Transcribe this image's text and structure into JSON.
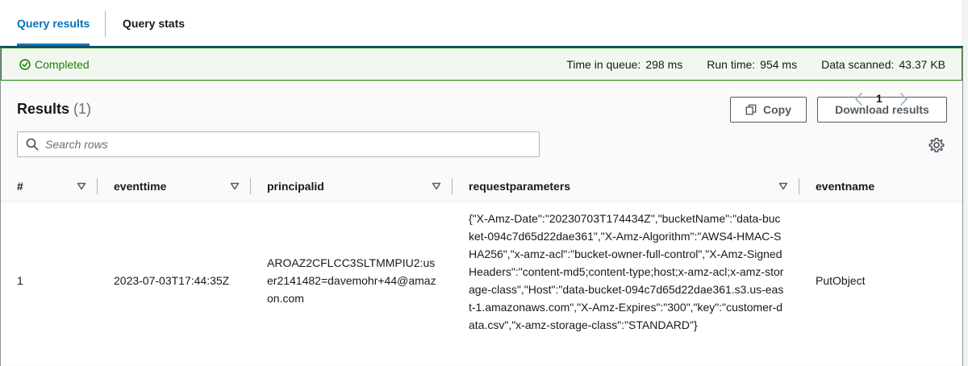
{
  "tabs": [
    {
      "label": "Query results",
      "active": true
    },
    {
      "label": "Query stats",
      "active": false
    }
  ],
  "status": {
    "label": "Completed",
    "icon": "check-circle-icon",
    "color": "#1d8102",
    "stats": [
      {
        "label": "Time in queue:",
        "value": "298 ms"
      },
      {
        "label": "Run time:",
        "value": "954 ms"
      },
      {
        "label": "Data scanned:",
        "value": "43.37 KB"
      }
    ]
  },
  "results": {
    "title": "Results",
    "count": "(1)",
    "copy_label": "Copy",
    "download_label": "Download results",
    "search_placeholder": "Search rows",
    "page": "1"
  },
  "table": {
    "columns": [
      "#",
      "eventtime",
      "principalid",
      "requestparameters",
      "eventname"
    ],
    "rows": [
      {
        "num": "1",
        "eventtime": "2023-07-03T17:44:35Z",
        "principalid": "AROAZ2CFLCC3SLTMMPIU2:user2141482=davemohr+44@amazon.com",
        "requestparameters": "{\"X-Amz-Date\":\"20230703T174434Z\",\"bucketName\":\"data-bucket-094c7d65d22dae361\",\"X-Amz-Algorithm\":\"AWS4-HMAC-SHA256\",\"x-amz-acl\":\"bucket-owner-full-control\",\"X-Amz-SignedHeaders\":\"content-md5;content-type;host;x-amz-acl;x-amz-storage-class\",\"Host\":\"data-bucket-094c7d65d22dae361.s3.us-east-1.amazonaws.com\",\"X-Amz-Expires\":\"300\",\"key\":\"customer-data.csv\",\"x-amz-storage-class\":\"STANDARD\"}",
        "eventname": "PutObject"
      }
    ]
  },
  "colors": {
    "accent": "#0073bb",
    "success": "#1d8102",
    "text": "#16191f",
    "muted": "#687078"
  }
}
